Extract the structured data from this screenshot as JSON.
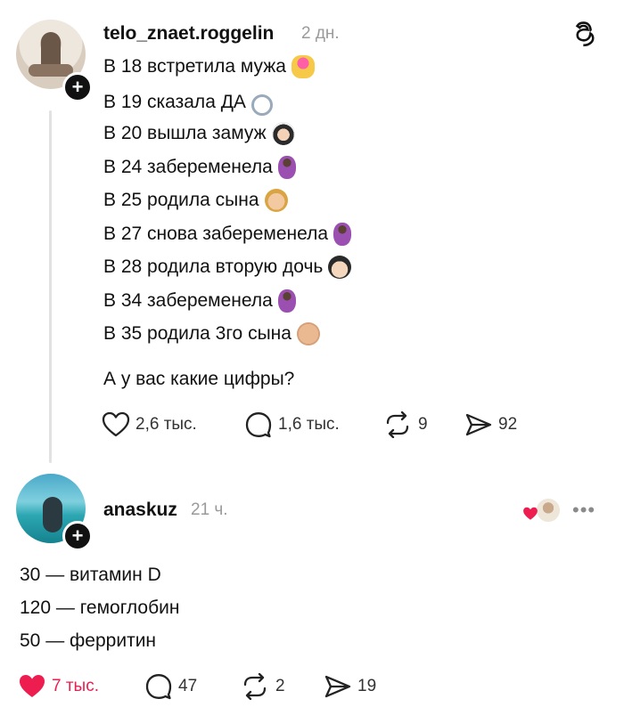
{
  "post": {
    "username": "telo_znaet.roggelin",
    "time": "2 дн.",
    "lines": [
      {
        "text": "В 18 встретила мужа",
        "emoji": "couple-emoji"
      },
      {
        "text": "В 19 сказала ДА",
        "emoji": "ring-emoji"
      },
      {
        "text": "В 20 вышла замуж",
        "emoji": "bride-emoji"
      },
      {
        "text": "В 24 забеременела",
        "emoji": "pregnant-emoji"
      },
      {
        "text": "В 25 родила сына",
        "emoji": "boy-emoji"
      },
      {
        "text": "В 27 снова забеременела",
        "emoji": "pregnant-emoji"
      },
      {
        "text": "В 28 родила вторую дочь",
        "emoji": "girl-emoji"
      },
      {
        "text": "В 34 забеременела",
        "emoji": "pregnant-emoji"
      },
      {
        "text": "В 35 родила 3го сына",
        "emoji": "baby-emoji"
      }
    ],
    "question": "А у вас какие цифры?",
    "actions": {
      "likes": "2,6 тыс.",
      "comments": "1,6 тыс.",
      "reposts": "9",
      "shares": "92"
    }
  },
  "reply": {
    "username": "anaskuz",
    "time": "21 ч.",
    "lines": [
      "30 — витамин D",
      "120 — гемоглобин",
      "50 — ферритин"
    ],
    "actions": {
      "likes": "7 тыс.",
      "comments": "47",
      "reposts": "2",
      "shares": "19"
    }
  },
  "icons": {
    "follow": "+",
    "more": "•••",
    "app_logo": "threads-icon"
  },
  "colors": {
    "liked": "#ee1d4f",
    "muted": "#9a9a9a",
    "text": "#111111"
  }
}
